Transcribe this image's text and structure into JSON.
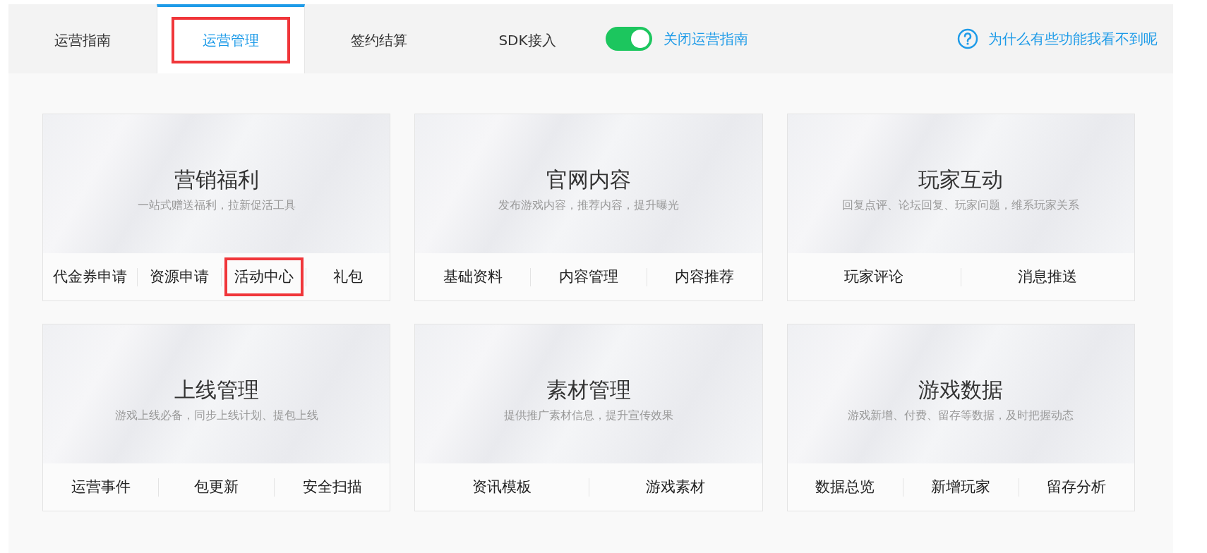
{
  "tabs": [
    {
      "label": "运营指南",
      "selected": false,
      "highlighted": false
    },
    {
      "label": "运营管理",
      "selected": true,
      "highlighted": true
    },
    {
      "label": "签约结算",
      "selected": false,
      "highlighted": false
    },
    {
      "label": "SDK接入",
      "selected": false,
      "highlighted": false
    }
  ],
  "guide_toggle": {
    "on": true,
    "label": "关闭运营指南"
  },
  "help_link": "为什么有些功能我看不到呢",
  "cards": [
    {
      "title": "营销福利",
      "subtitle": "一站式赠送福利，拉新促活工具",
      "links": [
        {
          "label": "代金券申请",
          "highlighted": false
        },
        {
          "label": "资源申请",
          "highlighted": false
        },
        {
          "label": "活动中心",
          "highlighted": true
        },
        {
          "label": "礼包",
          "highlighted": false
        }
      ]
    },
    {
      "title": "官网内容",
      "subtitle": "发布游戏内容，推荐内容，提升曝光",
      "links": [
        {
          "label": "基础资料",
          "highlighted": false
        },
        {
          "label": "内容管理",
          "highlighted": false
        },
        {
          "label": "内容推荐",
          "highlighted": false
        }
      ]
    },
    {
      "title": "玩家互动",
      "subtitle": "回复点评、论坛回复、玩家问题，维系玩家关系",
      "links": [
        {
          "label": "玩家评论",
          "highlighted": false
        },
        {
          "label": "消息推送",
          "highlighted": false
        }
      ]
    },
    {
      "title": "上线管理",
      "subtitle": "游戏上线必备，同步上线计划、提包上线",
      "links": [
        {
          "label": "运营事件",
          "highlighted": false
        },
        {
          "label": "包更新",
          "highlighted": false
        },
        {
          "label": "安全扫描",
          "highlighted": false
        }
      ]
    },
    {
      "title": "素材管理",
      "subtitle": "提供推广素材信息，提升宣传效果",
      "links": [
        {
          "label": "资讯模板",
          "highlighted": false
        },
        {
          "label": "游戏素材",
          "highlighted": false
        }
      ]
    },
    {
      "title": "游戏数据",
      "subtitle": "游戏新增、付费、留存等数据，及时把握动态",
      "links": [
        {
          "label": "数据总览",
          "highlighted": false
        },
        {
          "label": "新增玩家",
          "highlighted": false
        },
        {
          "label": "留存分析",
          "highlighted": false
        }
      ]
    }
  ]
}
